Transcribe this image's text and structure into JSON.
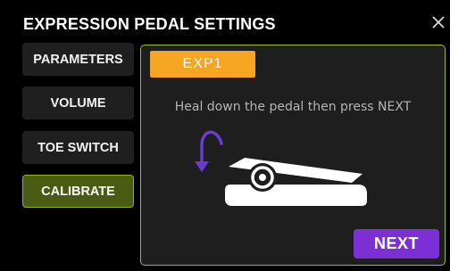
{
  "header": {
    "title": "EXPRESSION PEDAL SETTINGS",
    "close_icon": "close-icon"
  },
  "sidebar": {
    "items": [
      {
        "label": "PARAMETERS",
        "active": false
      },
      {
        "label": "VOLUME",
        "active": false
      },
      {
        "label": "TOE SWITCH",
        "active": false
      },
      {
        "label": "CALIBRATE",
        "active": true
      }
    ]
  },
  "panel": {
    "tab_label": "EXP1",
    "instruction": "Heal down the pedal then press NEXT",
    "next_label": "NEXT",
    "illustration_icons": [
      "curved-arrow-down-icon",
      "expression-pedal-icon"
    ]
  },
  "colors": {
    "accent_green": "#9abc2c",
    "active_fill": "#4a5c14",
    "tab_orange": "#f6a623",
    "next_purple": "#7b2fd4",
    "arrow_purple": "#6a3bd1"
  }
}
